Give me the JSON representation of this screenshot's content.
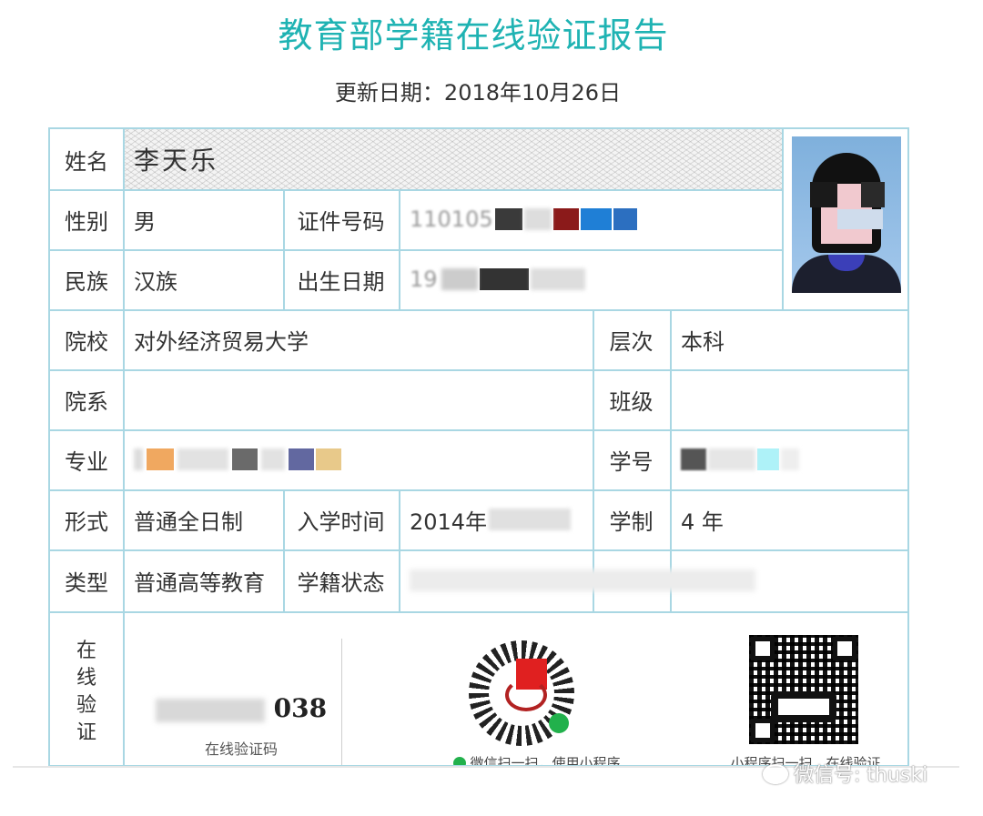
{
  "header": {
    "title": "教育部学籍在线验证报告",
    "update_date": "更新日期：2018年10月26日"
  },
  "record": {
    "name_label": "姓名",
    "name_value": "李天乐",
    "gender_label": "性别",
    "gender_value": "男",
    "id_label": "证件号码",
    "id_value_visible": "110105",
    "ethnicity_label": "民族",
    "ethnicity_value": "汉族",
    "birth_label": "出生日期",
    "birth_value_visible": "19",
    "school_label": "院校",
    "school_value": "对外经济贸易大学",
    "level_label": "层次",
    "level_value": "本科",
    "department_label": "院系",
    "department_value": "",
    "class_label": "班级",
    "class_value": "",
    "major_label": "专业",
    "student_no_label": "学号",
    "form_label": "形式",
    "form_value": "普通全日制",
    "enroll_label": "入学时间",
    "enroll_value_visible": "2014年",
    "duration_label": "学制",
    "duration_value": "4 年",
    "type_label": "类型",
    "type_value": "普通高等教育",
    "status_label": "学籍状态"
  },
  "verify": {
    "vertical_label": [
      "在",
      "线",
      "验",
      "证"
    ],
    "code_visible": "038",
    "code_caption": "在线验证码",
    "mini_program_caption": "微信扫一扫，使用小程序",
    "online_caption": "小程序扫一扫，在线验证"
  },
  "watermark": {
    "text": "微信号: thuski"
  },
  "colors": {
    "title": "#1fb3b3",
    "border": "#a9d7e3"
  }
}
